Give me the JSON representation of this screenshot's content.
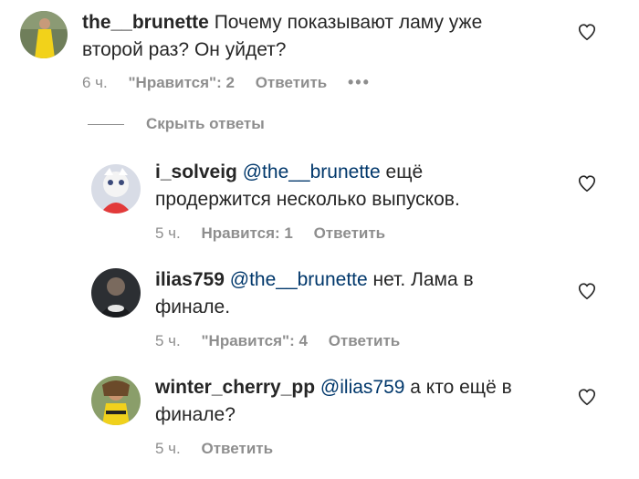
{
  "comments": [
    {
      "username": "the__brunette",
      "text": "Почему показывают ламу уже второй раз? Он уйдет?",
      "time": "6 ч.",
      "likes": "\"Нравится\": 2",
      "reply": "Ответить",
      "more": "•••"
    }
  ],
  "hide_replies": "Скрыть ответы",
  "replies": [
    {
      "username": "i_solveig",
      "mention": "@the__brunette",
      "text": "ещё продержится несколько выпусков.",
      "time": "5 ч.",
      "likes": "Нравится: 1",
      "reply": "Ответить"
    },
    {
      "username": "ilias759",
      "mention": "@the__brunette",
      "text": "нет. Лама в финале.",
      "time": "5 ч.",
      "likes": "\"Нравится\": 4",
      "reply": "Ответить"
    },
    {
      "username": "winter_cherry_pp",
      "mention": "@ilias759",
      "text": "а кто ещё в финале?",
      "time": "5 ч.",
      "reply": "Ответить"
    }
  ],
  "icons": {
    "like": "heart-outline-icon"
  },
  "colors": {
    "mention": "#00376b",
    "meta": "#8e8e8e",
    "text": "#262626"
  }
}
